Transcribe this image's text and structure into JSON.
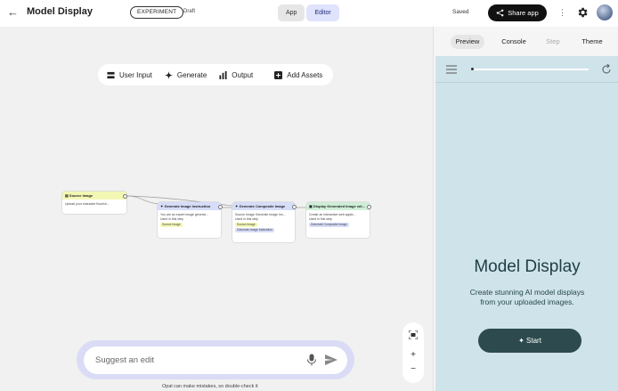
{
  "header": {
    "back_icon": "arrow-back-icon",
    "title": "Model Display",
    "badge": "EXPERIMENT",
    "status": "Draft",
    "mode_app": "App",
    "mode_editor": "Editor",
    "saved": "Saved",
    "share_label": "Share app"
  },
  "toolbar": {
    "user_input": "User Input",
    "generate": "Generate",
    "output": "Output",
    "add_assets": "Add Assets"
  },
  "nodes": [
    {
      "title": "Source Image",
      "body": "Upload your character flourish...",
      "color": "#f3f7b4"
    },
    {
      "title": "Generate Image Instruction",
      "body": "You are an expert image generat...",
      "used": "Used in this step",
      "chip": "Source Image",
      "color": "#d6ddf9"
    },
    {
      "title": "Generate Composite Image",
      "body": "Source Image Generate Image Ins...",
      "used": "Used in this step",
      "chip1": "Source Image",
      "chip2": "Generate Image Instruction",
      "color": "#d6ddf9"
    },
    {
      "title": "Display Generated Image edi...",
      "body": "Create an interactive web applic...",
      "used": "Used in this step",
      "chip": "Generate Composite Image",
      "color": "#cfeed7"
    }
  ],
  "zoom": {
    "plus": "+",
    "minus": "−"
  },
  "suggest": {
    "placeholder": "Suggest an edit",
    "disclaimer": "Opal can make mistakes, so double-check it"
  },
  "panel": {
    "tabs": [
      "Preview",
      "Console",
      "Step",
      "Theme"
    ],
    "app_title": "Model Display",
    "app_description": "Create stunning AI model displays from your uploaded images.",
    "start_label": "Start"
  },
  "colors": {
    "accent": "#dfe3fb",
    "preview_bg": "#cfe3ea",
    "start_button": "#2d4b4f"
  }
}
